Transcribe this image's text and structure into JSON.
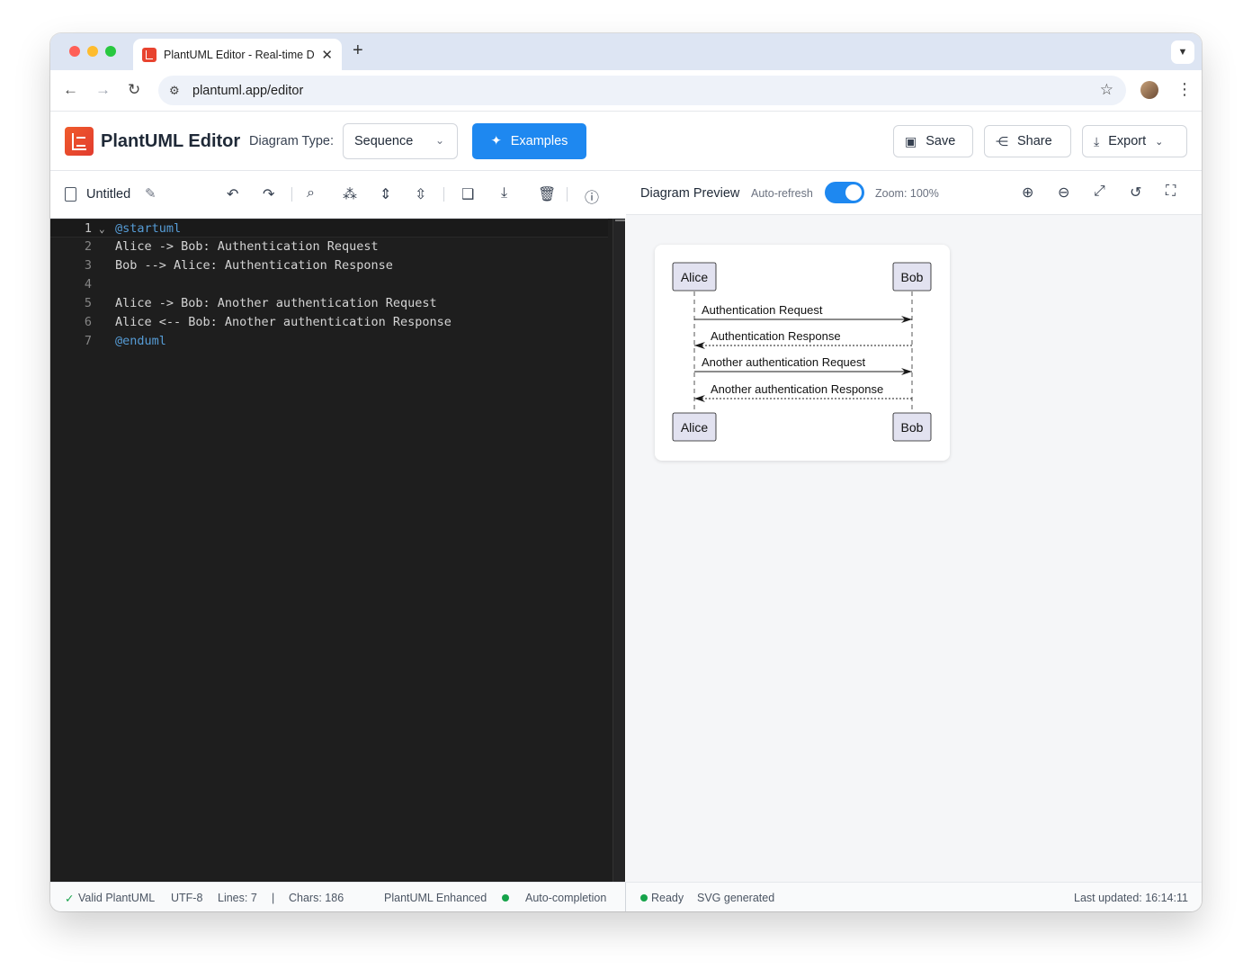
{
  "browser": {
    "tab_title": "PlantUML Editor - Real-time D",
    "url": "plantuml.app/editor",
    "new_tab": "+"
  },
  "header": {
    "app_title": "PlantUML Editor",
    "diagram_type_label": "Diagram Type:",
    "diagram_type_value": "Sequence",
    "examples_label": "Examples",
    "save_label": "Save",
    "share_label": "Share",
    "export_label": "Export",
    "brand_color": "#e8432f",
    "accent_color": "#1e88f0"
  },
  "editor": {
    "file_name": "Untitled",
    "toolbar_icons": [
      "undo-icon",
      "redo-icon",
      "search-icon",
      "regex-replace-icon",
      "collapse-icon",
      "expand-icon",
      "book-icon",
      "download-icon",
      "trash-icon",
      "help-icon"
    ],
    "lines": [
      {
        "num": "1",
        "text": "@startuml",
        "kw": true
      },
      {
        "num": "2",
        "text": "Alice -> Bob: Authentication Request",
        "kw": false
      },
      {
        "num": "3",
        "text": "Bob --> Alice: Authentication Response",
        "kw": false
      },
      {
        "num": "4",
        "text": "",
        "kw": false
      },
      {
        "num": "5",
        "text": "Alice -> Bob: Another authentication Request",
        "kw": false
      },
      {
        "num": "6",
        "text": "Alice <-- Bob: Another authentication Response",
        "kw": false
      },
      {
        "num": "7",
        "text": "@enduml",
        "kw": true
      }
    ]
  },
  "preview": {
    "title": "Diagram Preview",
    "auto_refresh_label": "Auto-refresh",
    "auto_refresh_on": true,
    "zoom_label": "Zoom: 100%",
    "diagram": {
      "participants": [
        "Alice",
        "Bob"
      ],
      "messages": [
        {
          "text": "Authentication Request",
          "direction": "right",
          "dashed": false
        },
        {
          "text": "Authentication Response",
          "direction": "left",
          "dashed": true
        },
        {
          "text": "Another authentication Request",
          "direction": "right",
          "dashed": false
        },
        {
          "text": "Another authentication Response",
          "direction": "left",
          "dashed": true
        }
      ]
    }
  },
  "status": {
    "valid": "Valid PlantUML",
    "encoding": "UTF-8",
    "lines": "Lines: 7",
    "sep": "|",
    "chars": "Chars: 186",
    "mode": "PlantUML Enhanced",
    "autocomplete": "Auto-completion",
    "ready": "Ready",
    "svg": "SVG generated",
    "last_updated": "Last updated: 16:14:11"
  }
}
